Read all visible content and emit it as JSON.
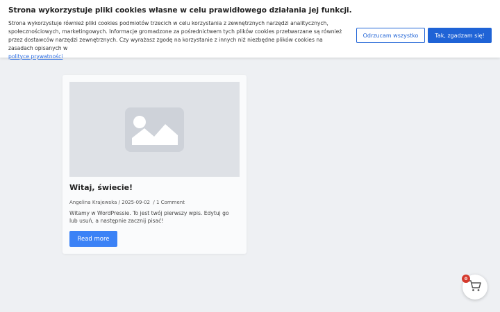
{
  "cookie": {
    "title": "Strona wykorzystuje pliki cookies własne w celu prawidłowego działania jej funkcji.",
    "text": "Strona wykorzystuje również pliki cookies podmiotów trzecich w celu korzystania z zewnętrznych narzędzi analitycznych, społecznościowych, marketingowych. Informacje gromadzone za pośrednictwem tych plików cookies przetwarzane są również przez dostawców narzędzi zewnętrznych. Czy wyrażasz zgodę na korzystanie z innych niż niezbędne plików cookies na zasadach opisanych w ",
    "policy_link": "polityce prywatności",
    "decline_label": "Odrzucam wszystko",
    "accept_label": "Tak, zgadzam się!"
  },
  "post": {
    "title": "Witaj, świecie!",
    "author": "Angelina Krajewska",
    "date": "2025-09-02",
    "comments": "1 Comment",
    "excerpt": "Witamy w WordPressie. To jest twój pierwszy wpis. Edytuj go lub usuń, a następnie zacznij pisać!",
    "read_more": "Read more",
    "thumbnail_icon": "image-placeholder-icon"
  },
  "cart": {
    "count": "0",
    "icon": "shopping-cart-icon"
  },
  "colors": {
    "accent": "#1f63d6",
    "button": "#3b82f6",
    "badge": "#d53a2d",
    "background": "#eef0f3"
  }
}
